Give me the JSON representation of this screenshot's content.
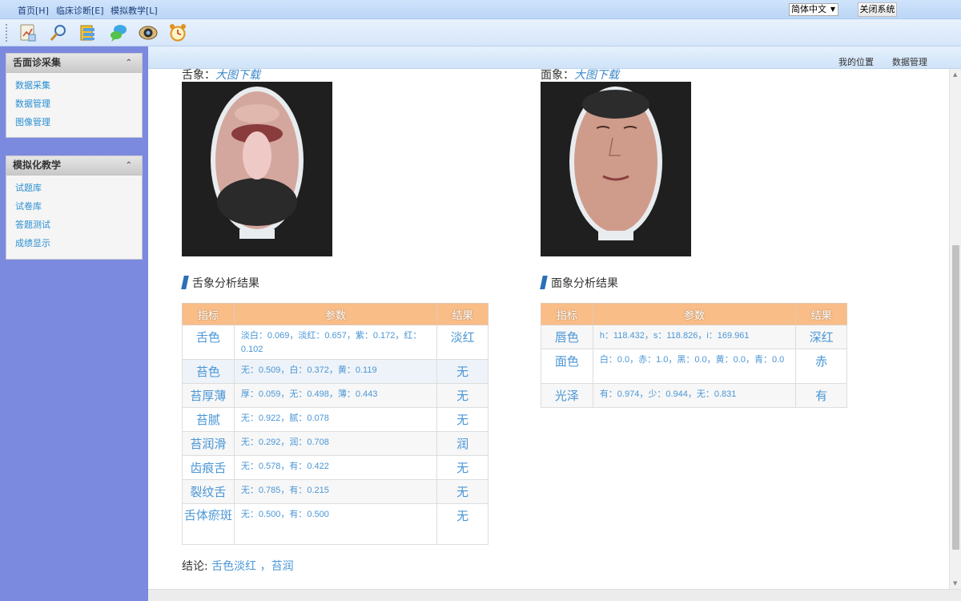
{
  "menu": {
    "items": [
      {
        "label": "首页[H]"
      },
      {
        "label": "临床诊断[E]"
      },
      {
        "label": "模拟教学[L]"
      }
    ],
    "language": "简体中文",
    "close_label": "关闭系统"
  },
  "toolbar": {
    "icons": [
      "document-chart-icon",
      "magnifier-icon",
      "folders-icon",
      "chat-bubbles-icon",
      "camera-lens-icon",
      "alarm-clock-icon"
    ]
  },
  "sidebar": {
    "panels": [
      {
        "title": "舌面诊采集",
        "items": [
          "数据采集",
          "数据管理",
          "图像管理"
        ]
      },
      {
        "title": "模拟化教学",
        "items": [
          "试题库",
          "试卷库",
          "答题测试",
          "成绩显示"
        ]
      }
    ]
  },
  "breadcrumb": {
    "location": "我的位置",
    "current": "数据管理"
  },
  "tongue": {
    "label": "舌象：",
    "download": "大图下载",
    "section_title": "舌象分析结果",
    "headers": [
      "指标",
      "参数",
      "结果"
    ],
    "rows": [
      {
        "indicator": "舌色",
        "params": "淡白：0.069，淡红：0.657，紫：0.172，红：0.102",
        "result": "淡红"
      },
      {
        "indicator": "苔色",
        "params": "无：0.509，白：0.372，黄：0.119",
        "result": "无"
      },
      {
        "indicator": "苔厚薄",
        "params": "厚：0.059，无：0.498，薄：0.443",
        "result": "无"
      },
      {
        "indicator": "苔腻",
        "params": "无：0.922，腻：0.078",
        "result": "无"
      },
      {
        "indicator": "苔润滑",
        "params": "无：0.292，润：0.708",
        "result": "润"
      },
      {
        "indicator": "齿痕舌",
        "params": "无：0.578，有：0.422",
        "result": "无"
      },
      {
        "indicator": "裂纹舌",
        "params": "无：0.785，有：0.215",
        "result": "无"
      },
      {
        "indicator": "舌体瘀斑",
        "params": "无：0.500，有：0.500",
        "result": "无"
      }
    ]
  },
  "face": {
    "label": "面象：",
    "download": "大图下载",
    "section_title": "面象分析结果",
    "headers": [
      "指标",
      "参数",
      "结果"
    ],
    "rows": [
      {
        "indicator": "唇色",
        "params": "h：118.432，s：118.826，i：169.961",
        "result": "深红"
      },
      {
        "indicator": "面色",
        "params": "白：0.0，赤：1.0，黑：0.0，黄：0.0，青：0.0",
        "result": "赤"
      },
      {
        "indicator": "光泽",
        "params": "有：0.974，少：0.944，无：0.831",
        "result": "有"
      }
    ]
  },
  "conclusion": {
    "label": "结论: ",
    "value": "舌色淡红 ，苔润"
  }
}
